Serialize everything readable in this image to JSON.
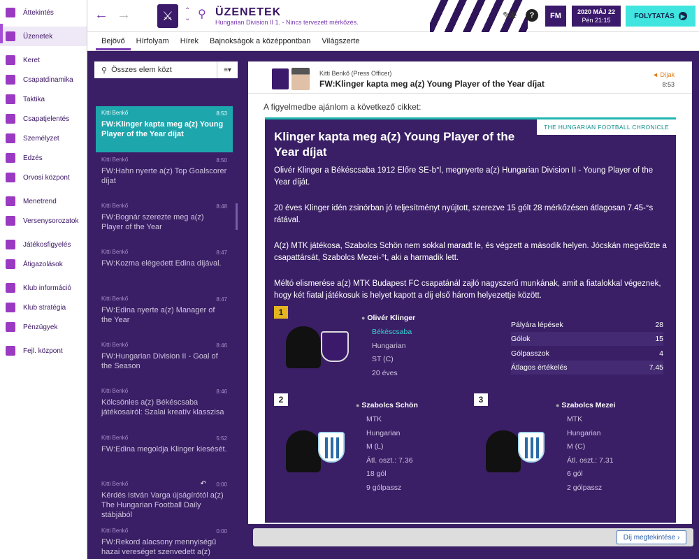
{
  "nav": {
    "items": [
      {
        "label": "Áttekintés",
        "icon": "home-icon"
      },
      {
        "label": "Üzenetek",
        "icon": "inbox-icon"
      },
      {
        "label": "Keret",
        "icon": "squad-icon"
      },
      {
        "label": "Csapatdinamika",
        "icon": "dynamics-icon"
      },
      {
        "label": "Taktika",
        "icon": "tactics-icon"
      },
      {
        "label": "Csapatjelentés",
        "icon": "report-icon"
      },
      {
        "label": "Személyzet",
        "icon": "staff-icon"
      },
      {
        "label": "Edzés",
        "icon": "training-icon"
      },
      {
        "label": "Orvosi központ",
        "icon": "medical-icon"
      },
      {
        "label": "Menetrend",
        "icon": "calendar-icon"
      },
      {
        "label": "Versenysorozatok",
        "icon": "trophy-icon"
      },
      {
        "label": "Játékosfigyelés",
        "icon": "scouting-icon"
      },
      {
        "label": "Átigazolások",
        "icon": "transfers-icon"
      },
      {
        "label": "Klub információ",
        "icon": "shield-icon"
      },
      {
        "label": "Klub stratégia",
        "icon": "strategy-icon"
      },
      {
        "label": "Pénzügyek",
        "icon": "finances-icon"
      },
      {
        "label": "Fejl. központ",
        "icon": "development-icon"
      }
    ]
  },
  "header": {
    "title": "ÜZENETEK",
    "subtitle": "Hungarian Division II 1. - Nincs tervezett mérkőzés.",
    "fm_label": "FM",
    "date": "2020 MÁJ 22",
    "time": "Pén 21:15",
    "continue_label": "FOLYTATÁS",
    "help_label": "?"
  },
  "tabs": [
    {
      "label": "Bejövő",
      "active": true
    },
    {
      "label": "Hírfolyam",
      "active": false
    },
    {
      "label": "Hírek",
      "active": false
    },
    {
      "label": "Bajnokságok a középpontban",
      "active": false
    },
    {
      "label": "Világszerte",
      "active": false
    }
  ],
  "search": {
    "placeholder": "Összes elem közt"
  },
  "messages": [
    {
      "from": "Kitti Benkő",
      "time": "8:53",
      "subject": "FW:Klinger kapta meg a(z) Young Player of the Year díjat",
      "selected": true
    },
    {
      "from": "Kitti Benkő",
      "time": "8:50",
      "subject": "FW:Hahn nyerte a(z) Top Goalscorer díjat",
      "selected": false
    },
    {
      "from": "Kitti Benkő",
      "time": "8:48",
      "subject": "FW:Bognár szerezte meg a(z) Player of the Year",
      "selected": false
    },
    {
      "from": "Kitti Benkő",
      "time": "8:47",
      "subject": "FW:Kozma elégedett Edina díjával.",
      "selected": false
    },
    {
      "from": "Kitti Benkő",
      "time": "8:47",
      "subject": "FW:Edina nyerte a(z) Manager of the Year",
      "selected": false
    },
    {
      "from": "Kitti Benkő",
      "time": "8:46",
      "subject": "FW:Hungarian Division II - Goal of the Season",
      "selected": false
    },
    {
      "from": "Kitti Benkő",
      "time": "8:46",
      "subject": "Kölcsönles a(z) Békéscsaba játékosairól: Szalai kreatív klasszisa",
      "selected": false
    },
    {
      "from": "Kitti Benkő",
      "time": "5:52",
      "subject": "FW:Edina megoldja Klinger kiesését.",
      "selected": false
    },
    {
      "from": "Kitti Benkő",
      "time": "0:00",
      "subject": "Kérdés István Varga újságírótól a(z) The Hungarian Football Daily stábjából",
      "selected": false
    },
    {
      "from": "Kitti Benkő",
      "time": "0:00",
      "subject": "FW:Rekord alacsony mennyiségű hazai vereséget szenvedett a(z)",
      "selected": false
    }
  ],
  "message": {
    "sender": "Kitti Benkő",
    "sender_role": "(Press Officer)",
    "subject": "FW:Klinger kapta meg a(z) Young Player of the Year díjat",
    "tag": "Díjak",
    "time": "8:53",
    "intro": "A figyelmedbe ajánlom a következő cikket:",
    "publication": "THE HUNGARIAN FOOTBALL CHRONICLE",
    "article_title": "Klinger kapta meg a(z) Young Player of the Year díjat",
    "paragraphs": [
      "Olivér Klinger a Békéscsaba 1912 Előre SE-b°l, megnyerte a(z) Hungarian Division II - Young Player of the Year díját.",
      "20 éves Klinger idén zsinórban jó teljesítményt nyújtott, szerezve 15 gólt 28 mérkőzésen átlagosan 7.45-°s rátával.",
      "A(z) MTK játékosa, Szabolcs Schön nem sokkal maradt le, és végzett a második helyen. Jócskán megelőzte a csapattársát, Szabolcs Mezei-°t, aki a harmadik lett.",
      "Méltó elismerése a(z) MTK Budapest FC csapatánál zajló nagyszerű munkának, amit a fiatalokkal végeznek, hogy két fiatal játékosuk is helyet kapott a díj első három helyezettje között."
    ],
    "winner": {
      "place": "1",
      "name": "Olivér Klinger",
      "club": "Békéscsaba",
      "nationality": "Hungarian",
      "position": "ST (C)",
      "age": "20 éves",
      "stats": [
        {
          "label": "Pályára lépések",
          "value": "28"
        },
        {
          "label": "Gólok",
          "value": "15"
        },
        {
          "label": "Gólpasszok",
          "value": "4"
        },
        {
          "label": "Átlagos értékelés",
          "value": "7.45"
        }
      ]
    },
    "second": {
      "place": "2",
      "name": "Szabolcs Schön",
      "club": "MTK",
      "nationality": "Hungarian",
      "position": "M (L)",
      "rating": "Átl. oszt.: 7.36",
      "goals": "18 gól",
      "assists": "9 gólpassz"
    },
    "third": {
      "place": "3",
      "name": "Szabolcs Mezei",
      "club": "MTK",
      "nationality": "Hungarian",
      "position": "M (C)",
      "rating": "Átl. oszt.: 7.31",
      "goals": "6 gól",
      "assists": "2 gólpassz"
    },
    "award_button": "Díj megtekintése"
  },
  "colors": {
    "accent": "#7a3ab0",
    "teal": "#1ea6ad",
    "background": "#3a1f66",
    "continue": "#3fe5de"
  }
}
